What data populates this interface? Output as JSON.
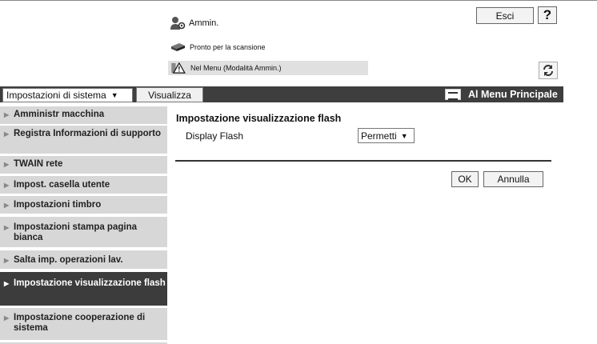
{
  "header": {
    "user_name": "Ammin.",
    "logout_label": "Esci",
    "help_label": "?"
  },
  "status": {
    "scan_ready": "Pronto per la scansione",
    "admin_mode": "Nel Menu (Modalità Ammin.)"
  },
  "topbar": {
    "system_settings_select": "Impostazioni di sistema",
    "view_button": "Visualizza",
    "main_menu_link": "Al Menu Principale"
  },
  "sidebar": {
    "items": [
      {
        "label": "Amministr macchina"
      },
      {
        "label": "Registra Informazioni di supporto"
      },
      {
        "label": "TWAIN rete"
      },
      {
        "label": "Impost. casella utente"
      },
      {
        "label": "Impostazioni timbro"
      },
      {
        "label": "Impostazioni stampa pagina bianca"
      },
      {
        "label": "Salta imp. operazioni lav."
      },
      {
        "label": "Impostazione visualizzazione flash",
        "active": true
      },
      {
        "label": "Impostazione cooperazione di sistema"
      }
    ]
  },
  "main": {
    "title": "Impostazione visualizzazione flash",
    "field_label": "Display Flash",
    "field_value": "Permetti",
    "ok_label": "OK",
    "cancel_label": "Annulla"
  },
  "icons": {
    "user": "admin-user-icon",
    "scanner": "scanner-icon",
    "warning": "warning-icon",
    "refresh": "refresh-icon",
    "main_menu": "menu-screen-icon",
    "nav_arrow": "triangle-right-icon"
  },
  "colors": {
    "topbar_bg": "#3e3e3e",
    "nav_bg": "#d7d7d7",
    "nav_active_bg": "#3c3c3c",
    "status_bar_bg": "#e0e0e0"
  }
}
